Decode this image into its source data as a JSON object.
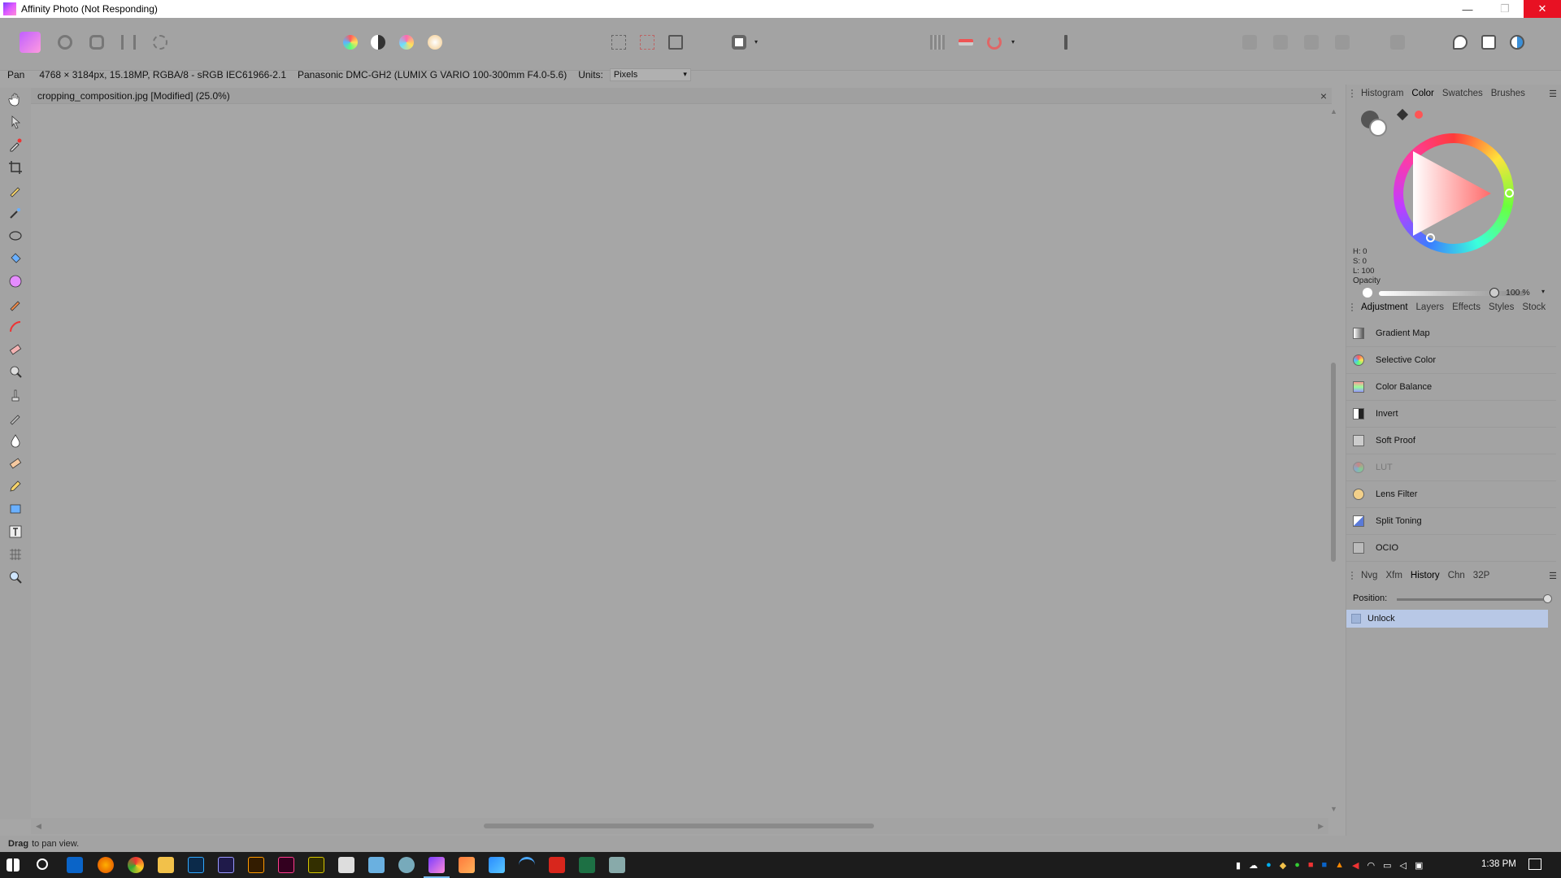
{
  "window": {
    "title": "Affinity Photo (Not Responding)",
    "controls": {
      "minimize": "—",
      "restore": "❐",
      "close": "✕"
    }
  },
  "context": {
    "tool_name": "Pan",
    "doc_info": "4768 × 3184px, 15.18MP, RGBA/8 - sRGB IEC61966-2.1",
    "camera": "Panasonic DMC-GH2 (LUMIX G VARIO 100-300mm F4.0-5.6)",
    "units_label": "Units:",
    "units_value": "Pixels"
  },
  "document": {
    "tab_title": "cropping_composition.jpg [Modified] (25.0%)",
    "close": "×"
  },
  "color_panel": {
    "tabs": [
      "Histogram",
      "Color",
      "Swatches",
      "Brushes"
    ],
    "active_tab": "Color",
    "h": "H: 0",
    "s": "S: 0",
    "l": "L: 100",
    "opacity_label": "Opacity",
    "opacity_value": "100 %"
  },
  "adjustment_panel": {
    "tabs": [
      "Adjustment",
      "Layers",
      "Effects",
      "Styles",
      "Stock"
    ],
    "active_tab": "Adjustment",
    "items": [
      {
        "label": "Gradient Map",
        "icon": "gradient-map-icon"
      },
      {
        "label": "Selective Color",
        "icon": "selective-color-icon"
      },
      {
        "label": "Color Balance",
        "icon": "color-balance-icon"
      },
      {
        "label": "Invert",
        "icon": "invert-icon"
      },
      {
        "label": "Soft Proof",
        "icon": "soft-proof-icon"
      },
      {
        "label": "LUT",
        "icon": "lut-icon",
        "disabled": true
      },
      {
        "label": "Lens Filter",
        "icon": "lens-filter-icon"
      },
      {
        "label": "Split Toning",
        "icon": "split-toning-icon"
      },
      {
        "label": "OCIO",
        "icon": "ocio-icon"
      }
    ]
  },
  "history_panel": {
    "tabs": [
      "Nvg",
      "Xfm",
      "History",
      "Chn",
      "32P"
    ],
    "active_tab": "History",
    "position_label": "Position:",
    "entries": [
      "Unlock"
    ]
  },
  "status": {
    "bold": "Drag",
    "rest": "to pan view."
  },
  "taskbar": {
    "time": "1:38 PM",
    "apps": [
      "start",
      "search",
      "outlook",
      "firefox",
      "chrome",
      "file-explorer",
      "photoshop",
      "after-effects",
      "illustrator",
      "indesign",
      "fireworks",
      "calculator",
      "notes",
      "app",
      "affinity-photo",
      "affinity-designer",
      "affinity-publisher",
      "wifi-app",
      "acrobat",
      "excel",
      "remote"
    ]
  },
  "colors": {
    "accent": "#b8c8e6",
    "close_red": "#e81123",
    "ui_gray": "#a3a3a3"
  }
}
